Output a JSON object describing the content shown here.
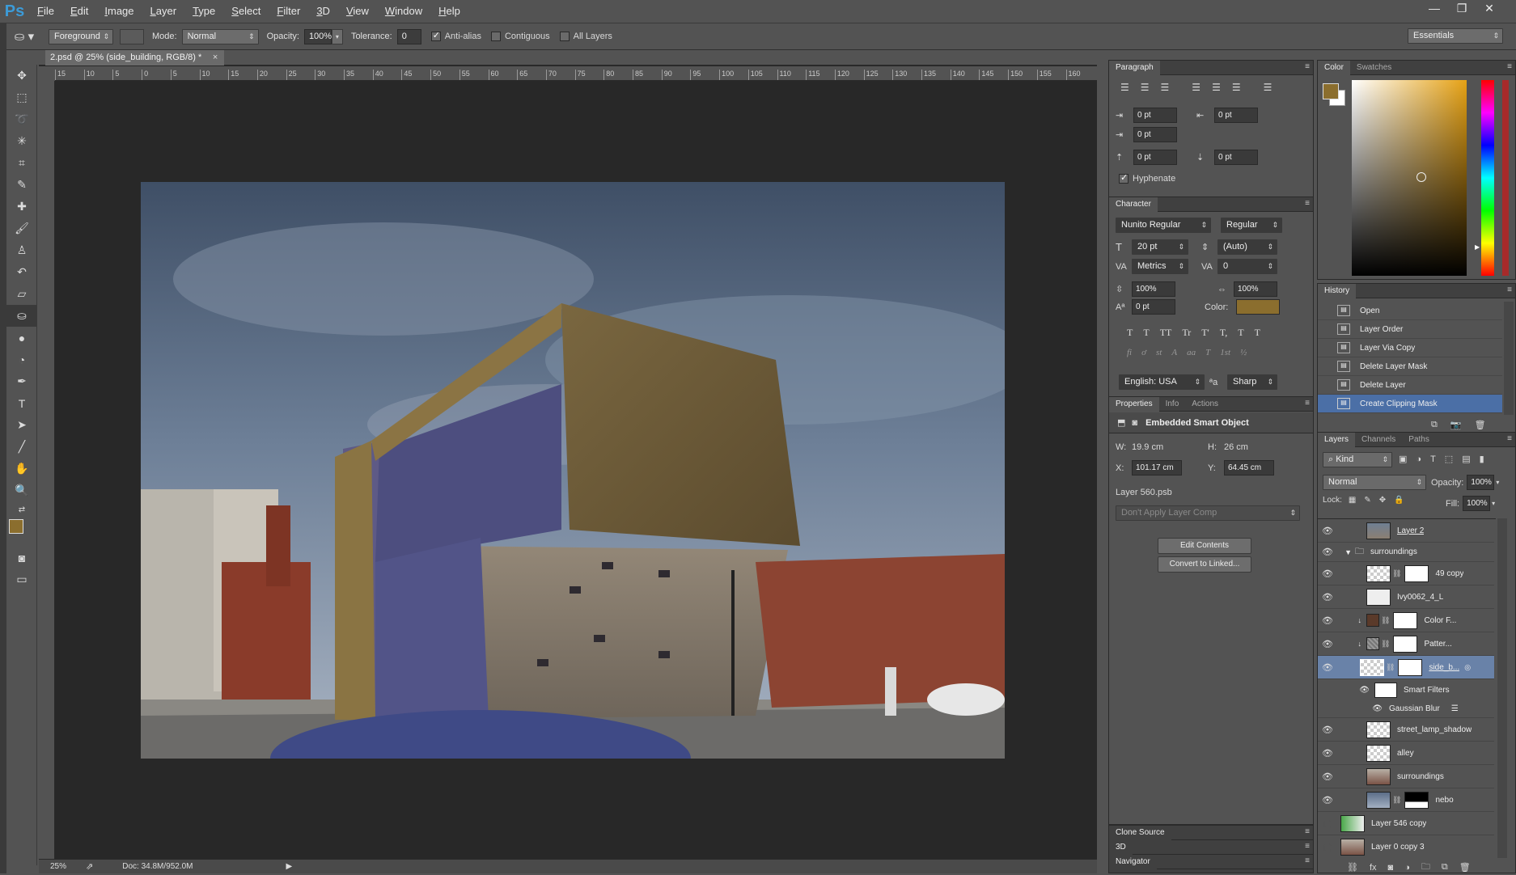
{
  "app": {
    "logo": "Ps"
  },
  "menu": [
    "File",
    "Edit",
    "Image",
    "Layer",
    "Type",
    "Select",
    "Filter",
    "3D",
    "View",
    "Window",
    "Help"
  ],
  "window_controls": [
    "—",
    "❐",
    "✕"
  ],
  "options": {
    "fill_source": "Foreground",
    "mode_label": "Mode:",
    "mode": "Normal",
    "opacity_label": "Opacity:",
    "opacity": "100%",
    "tolerance_label": "Tolerance:",
    "tolerance": "0",
    "antialias": "Anti-alias",
    "contiguous": "Contiguous",
    "all_layers": "All Layers",
    "workspace": "Essentials"
  },
  "document": {
    "tab_title": "2.psd @ 25% (side_building, RGB/8) *",
    "ruler_labels": [
      "15",
      "10",
      "5",
      "0",
      "5",
      "10",
      "15",
      "20",
      "25",
      "30",
      "35",
      "40",
      "45",
      "50",
      "55",
      "60",
      "65",
      "70",
      "75",
      "80",
      "85",
      "90",
      "95",
      "100",
      "105",
      "110",
      "115",
      "120",
      "125",
      "130",
      "135",
      "140",
      "145",
      "150",
      "155",
      "160"
    ],
    "zoom": "25%",
    "doc_size": "Doc: 34.8M/952.0M"
  },
  "paragraph": {
    "title": "Paragraph",
    "indent_left": "0 pt",
    "indent_right": "0 pt",
    "indent_first": "0 pt",
    "space_before": "0 pt",
    "space_after": "0 pt",
    "hyphenate": "Hyphenate"
  },
  "character": {
    "title": "Character",
    "font": "Nunito Regular",
    "style": "Regular",
    "size": "20 pt",
    "leading": "(Auto)",
    "kerning": "Metrics",
    "tracking": "0",
    "vscale": "100%",
    "hscale": "100%",
    "baseline": "0 pt",
    "color_label": "Color:",
    "language": "English: USA",
    "aa_label": "ªa",
    "antialias": "Sharp",
    "glyphs1": [
      "T",
      "T",
      "TT",
      "Tr",
      "T'",
      "T,",
      "T",
      "T"
    ],
    "glyphs2": [
      "fi",
      "ơ",
      "st",
      "A",
      "aa",
      "T",
      "1st",
      "½"
    ]
  },
  "properties": {
    "tabs": [
      "Properties",
      "Info",
      "Actions"
    ],
    "type": "Embedded Smart Object",
    "w_label": "W:",
    "w": "19.9 cm",
    "h_label": "H:",
    "h": "26 cm",
    "x_label": "X:",
    "x": "101.17 cm",
    "y_label": "Y:",
    "y": "64.45 cm",
    "file": "Layer 560.psb",
    "comp": "Don't Apply Layer Comp",
    "edit_btn": "Edit Contents",
    "convert_btn": "Convert to Linked..."
  },
  "bottom_panels": [
    "Clone Source",
    "3D",
    "Navigator"
  ],
  "color": {
    "tabs": [
      "Color",
      "Swatches"
    ],
    "fg": "#8b6e2e",
    "bg": "#ffffff"
  },
  "history": {
    "title": "History",
    "items": [
      "Open",
      "Layer Order",
      "Layer Via Copy",
      "Delete Layer Mask",
      "Delete Layer",
      "Create Clipping Mask"
    ]
  },
  "layers": {
    "tabs": [
      "Layers",
      "Channels",
      "Paths"
    ],
    "kind": "Kind",
    "blend": "Normal",
    "opacity_label": "Opacity:",
    "opacity": "100%",
    "lock_label": "Lock:",
    "fill_label": "Fill:",
    "fill": "100%",
    "items": [
      {
        "name": "Layer 2"
      },
      {
        "name": "surroundings"
      },
      {
        "name": "49 copy"
      },
      {
        "name": "Ivy0062_4_L"
      },
      {
        "name": "Color F..."
      },
      {
        "name": "Patter..."
      },
      {
        "name": "side_b..."
      },
      {
        "name": "Smart Filters"
      },
      {
        "name": "Gaussian Blur"
      },
      {
        "name": "street_lamp_shadow"
      },
      {
        "name": "alley"
      },
      {
        "name": "surroundings"
      },
      {
        "name": "nebo"
      },
      {
        "name": "Layer 546 copy"
      },
      {
        "name": "Layer 0 copy 3"
      }
    ]
  }
}
